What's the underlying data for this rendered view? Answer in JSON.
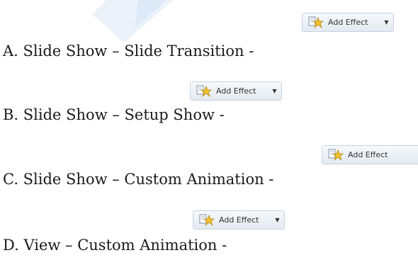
{
  "options": [
    {
      "text": "A. Slide Show – Slide Transition -",
      "button_label": "Add Effect",
      "has_caret": true
    },
    {
      "text": "B. Slide Show – Setup Show -",
      "button_label": "Add Effect",
      "has_caret": true
    },
    {
      "text": "C. Slide Show – Custom Animation -",
      "button_label": "Add Effect",
      "has_caret": false
    },
    {
      "text": "D. View – Custom Animation -",
      "button_label": "Add Effect",
      "has_caret": true
    }
  ],
  "icons": {
    "button_icon": "add-effect-star-icon",
    "caret_icon": "chevron-down-icon"
  },
  "colors": {
    "watermark": "#dde8f7",
    "button_border": "#c9d3df",
    "star_fill": "#f2c12e"
  }
}
